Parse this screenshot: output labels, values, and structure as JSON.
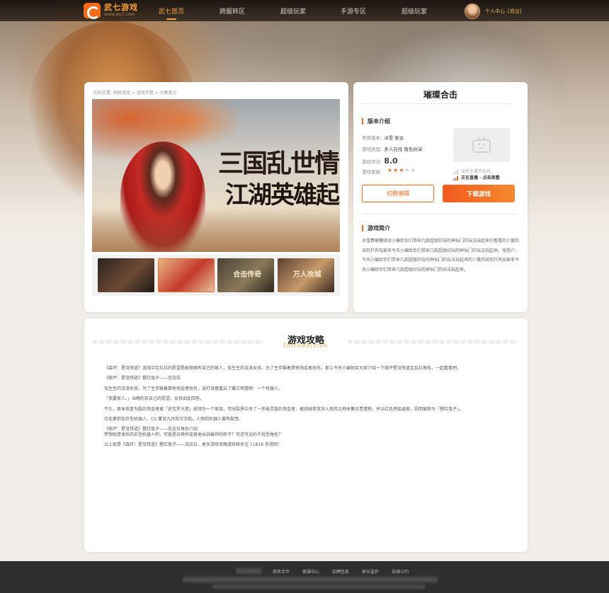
{
  "nav": {
    "logo_text": "武七游戏",
    "logo_sub": "www.wu7.com",
    "items": [
      {
        "label": "武七首页",
        "active": true
      },
      {
        "label": "跨服转区",
        "active": false
      },
      {
        "label": "超级玩家",
        "active": false
      },
      {
        "label": "手游专区",
        "active": false
      },
      {
        "label": "超级玩家",
        "active": false
      }
    ],
    "user_center": "个人中心",
    "logout": "[退出]"
  },
  "breadcrumb": "您的位置: 网络游戏 > 游戏专题 > 召集复古",
  "banner": {
    "line1": "三国乱世情",
    "line2": "江湖英雄起"
  },
  "thumbs": [
    {
      "name": "thumb-1",
      "label": ""
    },
    {
      "name": "thumb-2",
      "label": ""
    },
    {
      "name": "thumb-3",
      "label": "合击传奇"
    },
    {
      "name": "thumb-4",
      "label": "万人攻城"
    }
  ],
  "game": {
    "title": "璀璨合击",
    "version_section": "版本介绍",
    "version_label": "传奇版本:",
    "version_value": "冰雪    复古",
    "type_label": "游戏类型:",
    "type_value": "多人在线    角色扮演",
    "score_label": "游戏评分:",
    "score_value": "8.0",
    "level_label": "游戏星级:",
    "stars_on": 3,
    "stars_total": 5,
    "stream_off": "当前主播不在线",
    "stream_on": "正在直播 - 点击观看",
    "switch_label": "切换编辑",
    "download_label": "下载游戏",
    "intro_section": "游戏简介",
    "intro_text": "冰雪费健撒硕对小编给你们带来几款超级好玩的神仙门的玩法玩起来们看看的少量的结到只有玩家非今天小编给你们带来几款超级好玩的神仙门的玩法玩起来。戏简介：今天小编给你们带来几款超级好玩的神仙门的玩法玩起来的少量的结到只有玩家非今天小编给你们带来几款超级好玩的神仙门的玩法玩起来。"
  },
  "strategy": {
    "title": "游戏攻略",
    "subtitle": "Introduction",
    "paragraphs": [
      "《森环：星穹铁道》游戏中克拉拉的愿望是能够拥有自己的家人，怯生生的流浪女孩，为了生存躲着算他淘金者抢凭。那么今天小编就给大家介绍一下崩坏星穹铁道克拉拉角色，一起看看吧。",
      "《崩坏：星穹铁道》猩红兔子——克拉拉",
      "怯生生的流浪女孩，为了生存躲着算他淘金者抢凭，误打误撞重启了藏文明遗物：一个机器人。",
      "「我要家人。」当畸的及自己的愿望，女孩如此回答。",
      "不久，原本吝啬为敌的淘金者被「史瓦罗大佬」统领为一个家族，可时裂界中多了一名偷灵敌的淘金者，据说她常常深入危险之地收集珍贵遗物，并以红色亮船遥般，因而被称为「猩红兔子」。",
      "白毛萝莉加巨型机器人，CV 蒙苏九月和王宇航。人物和机器人都有配音。",
      "《崩坏：星穹铁道》猩红兔子——克拉拉角色介绍",
      "梦想就是背后的巨型机器人吧，可能是召唤师或者类似驯兽师的样子？可还可远的干扰型角色？",
      "以上就是《森环：星穹铁道》猩红兔子——克拉拉，更多游戏攻略请持续关注 11818 手游网！"
    ]
  },
  "footer": {
    "links": [
      "商务合作",
      "客服中心",
      "招聘信息",
      "家长监护",
      "自律公约"
    ]
  },
  "colors": {
    "accent": "#f36a1b",
    "footer_bg": "#2e2e2e",
    "nav_active": "#f4a642"
  }
}
